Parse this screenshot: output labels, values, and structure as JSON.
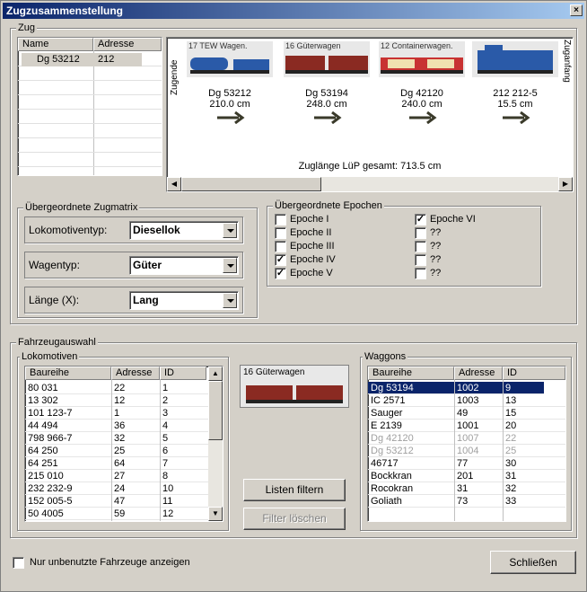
{
  "window": {
    "title": "Zugzusammenstellung",
    "close": "×"
  },
  "zug": {
    "legend": "Zug",
    "table": {
      "headers": [
        "Name",
        "Adresse"
      ],
      "rows": [
        {
          "name": "Dg 53212",
          "adresse": "212"
        }
      ]
    },
    "labels": {
      "zugende": "Zugende",
      "zuganfang": "Zuganfang"
    },
    "cars": [
      {
        "caption": "17 TEW Wagen.",
        "name": "Dg 53212",
        "length": "210.0 cm"
      },
      {
        "caption": "16 Güterwagen",
        "name": "Dg 53194",
        "length": "248.0 cm"
      },
      {
        "caption": "12 Containerwagen.",
        "name": "Dg 42120",
        "length": "240.0 cm"
      },
      {
        "caption": "",
        "name": "212 212-5",
        "length": "15.5 cm"
      }
    ],
    "total": "Zuglänge LüP gesamt: 713.5 cm"
  },
  "zugmatrix": {
    "legend": "Übergeordnete Zugmatrix",
    "lokotyp": {
      "label": "Lokomotiventyp:",
      "value": "Diesellok"
    },
    "wagentyp": {
      "label": "Wagentyp:",
      "value": "Güter"
    },
    "laenge": {
      "label": "Länge (X):",
      "value": "Lang"
    }
  },
  "epochen": {
    "legend": "Übergeordnete Epochen",
    "left": [
      {
        "label": "Epoche I",
        "checked": false
      },
      {
        "label": "Epoche II",
        "checked": false
      },
      {
        "label": "Epoche III",
        "checked": false
      },
      {
        "label": "Epoche IV",
        "checked": true
      },
      {
        "label": "Epoche V",
        "checked": true
      }
    ],
    "right": [
      {
        "label": "Epoche VI",
        "checked": true
      },
      {
        "label": "??",
        "checked": false
      },
      {
        "label": "??",
        "checked": false
      },
      {
        "label": "??",
        "checked": false
      },
      {
        "label": "??",
        "checked": false
      }
    ]
  },
  "fahrzeugauswahl": {
    "legend": "Fahrzeugauswahl",
    "lokomotiven": {
      "legend": "Lokomotiven",
      "headers": [
        "Baureihe",
        "Adresse",
        "ID"
      ],
      "rows": [
        [
          "80 031",
          "22",
          "1"
        ],
        [
          "13 302",
          "12",
          "2"
        ],
        [
          "101 123-7",
          "1",
          "3"
        ],
        [
          "44 494",
          "36",
          "4"
        ],
        [
          "798 966-7",
          "32",
          "5"
        ],
        [
          "64 250",
          "25",
          "6"
        ],
        [
          "64 251",
          "64",
          "7"
        ],
        [
          "215 010",
          "27",
          "8"
        ],
        [
          "232 232-9",
          "24",
          "10"
        ],
        [
          "152 005-5",
          "47",
          "11"
        ],
        [
          "50 4005",
          "59",
          "12"
        ]
      ]
    },
    "preview_caption": "16 Güterwagen",
    "btn_filtern": "Listen filtern",
    "btn_loeschen": "Filter löschen",
    "waggons": {
      "legend": "Waggons",
      "headers": [
        "Baureihe",
        "Adresse",
        "ID"
      ],
      "rows": [
        {
          "cells": [
            "Dg 53194",
            "1002",
            "9"
          ],
          "state": "selected"
        },
        {
          "cells": [
            "IC 2571",
            "1003",
            "13"
          ],
          "state": "normal"
        },
        {
          "cells": [
            "Sauger",
            "49",
            "15"
          ],
          "state": "normal"
        },
        {
          "cells": [
            "E 2139",
            "1001",
            "20"
          ],
          "state": "normal"
        },
        {
          "cells": [
            "Dg 42120",
            "1007",
            "22"
          ],
          "state": "disabled"
        },
        {
          "cells": [
            "Dg 53212",
            "1004",
            "25"
          ],
          "state": "disabled"
        },
        {
          "cells": [
            "46717",
            "77",
            "30"
          ],
          "state": "normal"
        },
        {
          "cells": [
            "Bockkran",
            "201",
            "31"
          ],
          "state": "normal"
        },
        {
          "cells": [
            "Rocokran",
            "31",
            "32"
          ],
          "state": "normal"
        },
        {
          "cells": [
            "Goliath",
            "73",
            "33"
          ],
          "state": "normal"
        }
      ]
    }
  },
  "footer": {
    "checkbox_label": "Nur unbenutzte Fahrzeuge anzeigen",
    "close_button": "Schließen"
  },
  "colors": {
    "selection": "#0a246a",
    "loco_blue": "#2a5aa8",
    "wagon_red": "#8a2a22"
  }
}
